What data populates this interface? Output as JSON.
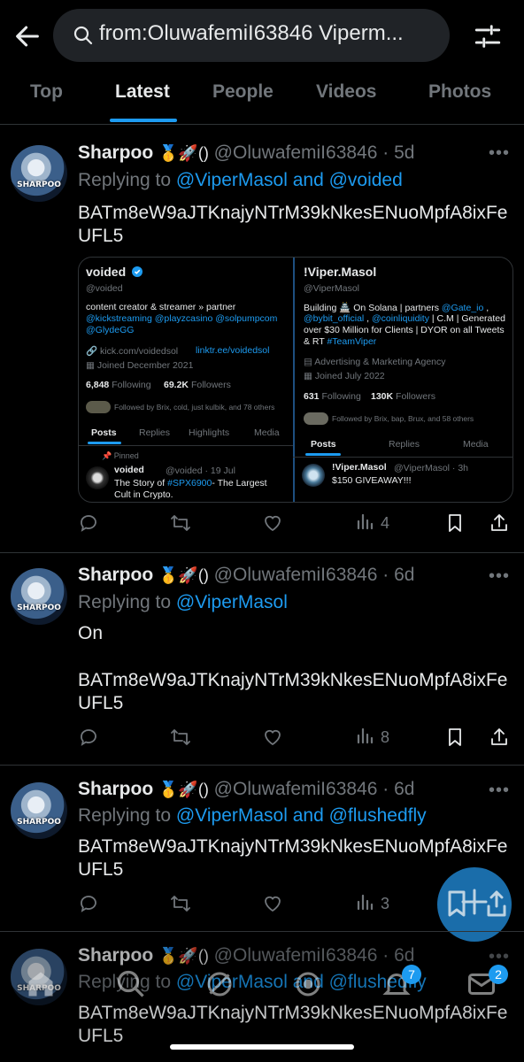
{
  "search": {
    "query": "from:OluwafemiI63846 Viperm..."
  },
  "tabs": [
    "Top",
    "Latest",
    "People",
    "Videos",
    "Photos"
  ],
  "active_tab": "Latest",
  "tweets": [
    {
      "name": "Sharpoo",
      "emojis": "🥇🚀()",
      "handle": "@OluwafemiI63846",
      "time": "5d",
      "replying_prefix": "Replying to",
      "replying_to": "@ViperMasol and @voided",
      "text": "BATm8eW9aJTKnajyNTrM39kNkesENuoMpfA8ixFeUFL5",
      "views": "4"
    },
    {
      "name": "Sharpoo",
      "emojis": "🥇🚀()",
      "handle": "@OluwafemiI63846",
      "time": "6d",
      "replying_prefix": "Replying to",
      "replying_to": "@ViperMasol",
      "text_line1": "On",
      "text": "BATm8eW9aJTKnajyNTrM39kNkesENuoMpfA8ixFeUFL5",
      "views": "8"
    },
    {
      "name": "Sharpoo",
      "emojis": "🥇🚀()",
      "handle": "@OluwafemiI63846",
      "time": "6d",
      "replying_prefix": "Replying to",
      "replying_to": "@ViperMasol and @flushedfly",
      "text": "BATm8eW9aJTKnajyNTrM39kNkesENuoMpfA8ixFeUFL5",
      "views": "3"
    },
    {
      "name": "Sharpoo",
      "emojis": "🥇🚀()",
      "handle": "@OluwafemiI63846",
      "time": "6d",
      "replying_prefix": "Replying to",
      "replying_to": "@ViperMasol and @flushedfly",
      "text": "BATm8eW9aJTKnajyNTrM39kNkesENuoMpfA8ixFeUFL5"
    }
  ],
  "avatar_label": "SHARPOO",
  "embed": {
    "left": {
      "name": "voided",
      "handle": "@voided",
      "bio": "content creator & streamer  » partner",
      "bio_links_1": "@kickstreaming @playzcasino @solpumpcom",
      "bio_links_2": "@GlydeGG",
      "link1": "kick.com/voidedsol",
      "link2": "linktr.ee/voidedsol",
      "joined": "Joined December 2021",
      "following_count": "6,848",
      "following_label": "Following",
      "followers_count": "69.2K",
      "followers_label": "Followers",
      "followed_by": "Followed by Brix, cold, just kulbik, and 78 others",
      "tabs": [
        "Posts",
        "Replies",
        "Highlights",
        "Media"
      ],
      "pinned": "Pinned",
      "post_name": "voided",
      "post_meta": "@voided · 19 Jul",
      "post_text_1": "The Story of",
      "post_tag": "#SPX6900",
      "post_text_2": "- The Largest",
      "post_text_3": "Cult in Crypto."
    },
    "right": {
      "name": "!Viper.Masol",
      "handle": "@ViperMasol",
      "bio_1a": "Building 🏯 On Solana | partners",
      "bio_1b": "@Gate_io",
      "bio_1c": ",",
      "bio_2a": "@bybit_official",
      "bio_2b": ",",
      "bio_2c": "@coinliquidity",
      "bio_2d": "| C.M | Generated",
      "bio_3": "over $30 Million for Clients | DYOR on all Tweets",
      "bio_4a": "& RT",
      "bio_4b": "#TeamViper",
      "category": "Advertising & Marketing Agency",
      "joined": "Joined July 2022",
      "following_count": "631",
      "following_label": "Following",
      "followers_count": "130K",
      "followers_label": "Followers",
      "followed_by": "Followed by Brix, bap, Brux, and 58 others",
      "tabs": [
        "Posts",
        "Replies",
        "Media"
      ],
      "post_name": "!Viper.Masol",
      "post_meta": "@ViperMasol · 3h",
      "post_text": "$150 GIVEAWAY!!!"
    }
  },
  "nav": {
    "notifications_badge": "7",
    "messages_badge": "2"
  },
  "colors": {
    "accent": "#1d9bf0",
    "background": "#000000",
    "muted": "#71767b",
    "divider": "#2f3336"
  }
}
